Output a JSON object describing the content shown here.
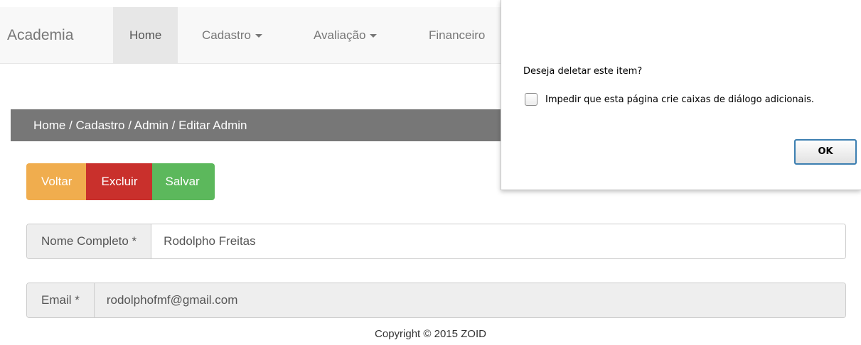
{
  "navbar": {
    "brand": "Academia",
    "items": [
      {
        "label": "Home"
      },
      {
        "label": "Cadastro"
      },
      {
        "label": "Avaliação"
      },
      {
        "label": "Financeiro"
      }
    ]
  },
  "breadcrumb": "Home / Cadastro / Admin / Editar Admin",
  "buttons": {
    "voltar": "Voltar",
    "excluir": "Excluir",
    "salvar": "Salvar"
  },
  "form": {
    "nome": {
      "label": "Nome Completo *",
      "value": "Rodolpho Freitas"
    },
    "email": {
      "label": "Email *",
      "value": "rodolphofmf@gmail.com"
    }
  },
  "footer": "Copyright © 2015 ZOID",
  "dialog": {
    "message": "Deseja deletar este item?",
    "checkbox_label": "Impedir que esta página crie caixas de diálogo adicionais.",
    "ok_label": "OK"
  },
  "colors": {
    "voltar": "#f0ad4e",
    "excluir": "#c9302c",
    "salvar": "#5cb85c",
    "breadcrumb_bg": "#777777"
  }
}
